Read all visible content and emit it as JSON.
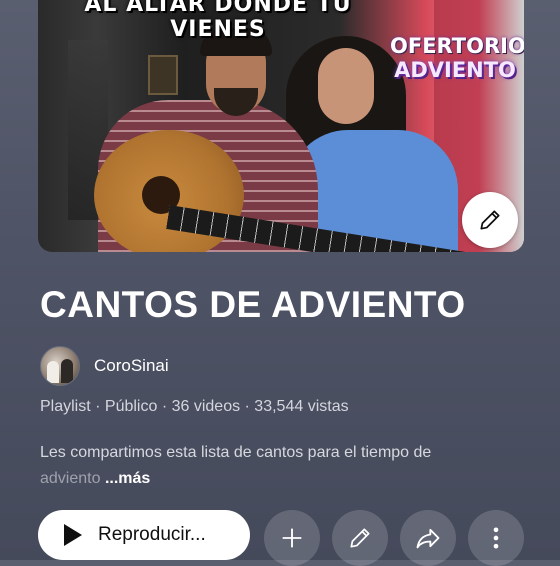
{
  "thumbnail": {
    "top_text": "AL ALTAR DONDE TU VIENES",
    "badge_line1": "OFERTORIO",
    "badge_line2": "ADVIENTO",
    "edit_icon": "pencil-icon"
  },
  "playlist": {
    "title": "CANTOS DE ADVIENTO",
    "channel": "CoroSinai",
    "meta": "Playlist · Público · 36 videos · 33,544 vistas",
    "description_visible": "Les compartimos esta lista de cantos para el tiempo de",
    "description_faded": "adviento",
    "more_label": "...más"
  },
  "actions": {
    "play_label": "Reproducir...",
    "play_icon": "play-icon",
    "add_icon": "plus-icon",
    "edit_icon": "pencil-icon",
    "share_icon": "share-icon",
    "more_icon": "more-vertical-icon"
  },
  "colors": {
    "background": "#50556a",
    "text_primary": "#ffffff",
    "text_secondary": "#d4d6de",
    "button_bg": "#ffffff"
  }
}
